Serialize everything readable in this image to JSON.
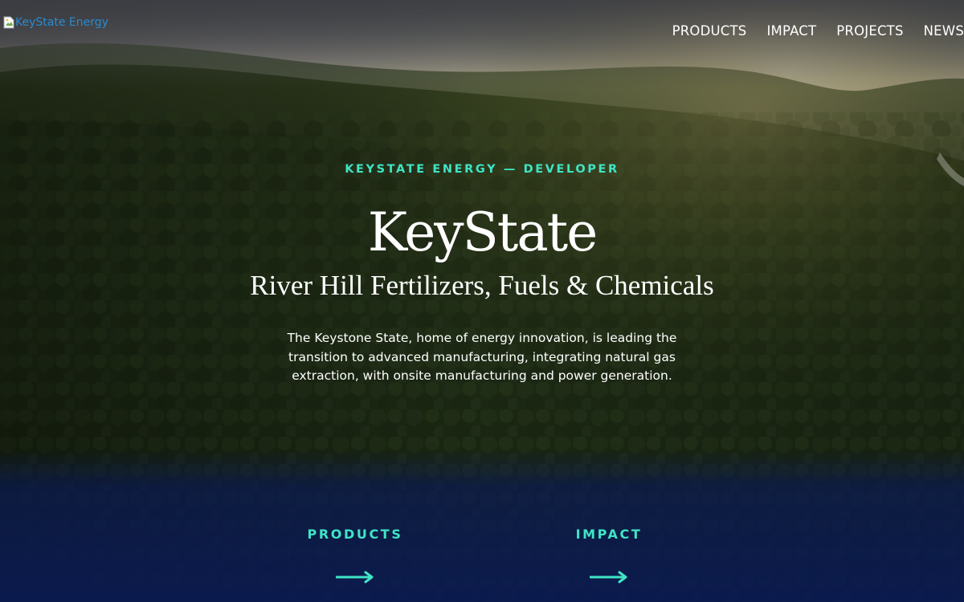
{
  "header": {
    "logo_alt": "KeyState Energy",
    "nav": [
      {
        "label": "PRODUCTS"
      },
      {
        "label": "IMPACT"
      },
      {
        "label": "PROJECTS"
      },
      {
        "label": "NEWS"
      }
    ]
  },
  "hero": {
    "eyebrow": "KEYSTATE ENERGY — DEVELOPER",
    "title": "KeyState",
    "subtitle": "River Hill Fertilizers, Fuels & Chemicals",
    "description": "The Keystone State, home of energy innovation, is leading the transition to advanced manufacturing, integrating natural gas extraction, with onsite manufacturing and power generation."
  },
  "cards": [
    {
      "label": "PRODUCTS",
      "icon": "arrow-right-icon"
    },
    {
      "label": "IMPACT",
      "icon": "arrow-right-icon"
    }
  ],
  "colors": {
    "accent": "#3fe4c6",
    "text": "#ffffff",
    "logo_link": "#2a8bd1",
    "footer_band": "#0a1a52"
  }
}
